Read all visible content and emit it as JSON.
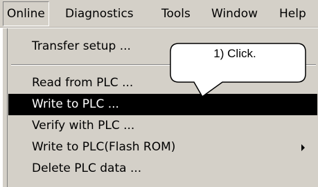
{
  "menubar": {
    "items": [
      {
        "label": "Online"
      },
      {
        "label": "Diagnostics"
      },
      {
        "label": "Tools"
      },
      {
        "label": "Window"
      },
      {
        "label": "Help"
      }
    ]
  },
  "dropdown": {
    "items": [
      {
        "label": "Transfer setup ..."
      },
      {
        "label": "Read from PLC ..."
      },
      {
        "label": "Write to PLC ..."
      },
      {
        "label": "Verify with PLC ..."
      },
      {
        "label": "Write to PLC(Flash ROM)"
      },
      {
        "label": "Delete PLC data ..."
      }
    ],
    "highlight_color": "#000000",
    "menu_bg_color": "#d4d0c8"
  },
  "callout": {
    "text": "1) Click."
  }
}
